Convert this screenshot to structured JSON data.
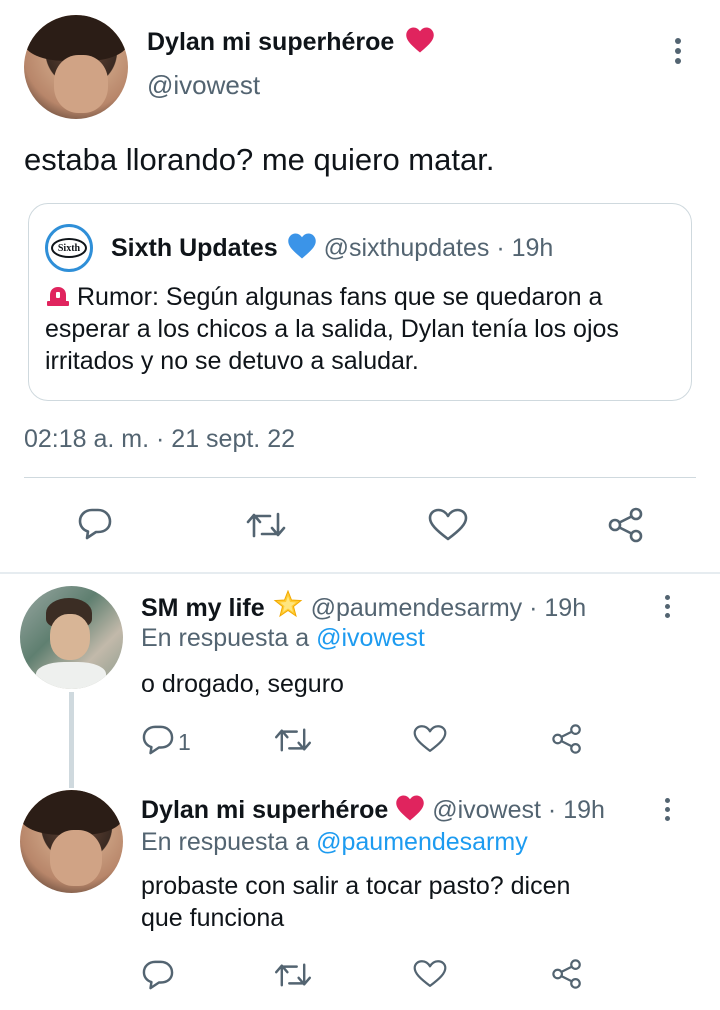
{
  "main_tweet": {
    "display_name": "Dylan mi superhéroe",
    "name_emoji": "heart",
    "handle": "@ivowest",
    "text": "estaba llorando? me quiero matar.",
    "timestamp": "02:18 a. m. · 21 sept. 22",
    "quote": {
      "avatar_text": "Sixth",
      "display_name": "Sixth Updates",
      "handle": "@sixthupdates",
      "separator": "·",
      "time": "19h",
      "text": "Rumor: Según algunas fans que se quedaron a esperar a los chicos a la salida, Dylan tenía los ojos irritados y no se detuvo a saludar.",
      "leading_icon": "siren-icon"
    }
  },
  "replies": [
    {
      "display_name": "SM my life",
      "name_emoji": "glowing-star",
      "handle": "@paumendesarmy",
      "separator": "·",
      "time": "19h",
      "replying_prefix": "En respuesta a",
      "replying_to": "@ivowest",
      "text": "o drogado, seguro",
      "reply_count": "1"
    },
    {
      "display_name": "Dylan mi superhéroe",
      "name_emoji": "heart",
      "handle": "@ivowest",
      "separator": "·",
      "time": "19h",
      "replying_prefix": "En respuesta a",
      "replying_to": "@paumendesarmy",
      "text_line1": "probaste con salir a tocar pasto? dicen",
      "text_line2": "que funciona",
      "reply_count": ""
    }
  ],
  "colors": {
    "accent": "#1d9bf0",
    "text": "#0f1419",
    "secondary": "#536471",
    "heart": "#e0245e"
  },
  "icons": [
    "reply-icon",
    "retweet-icon",
    "like-icon",
    "share-icon",
    "more-icon",
    "verified-icon"
  ]
}
